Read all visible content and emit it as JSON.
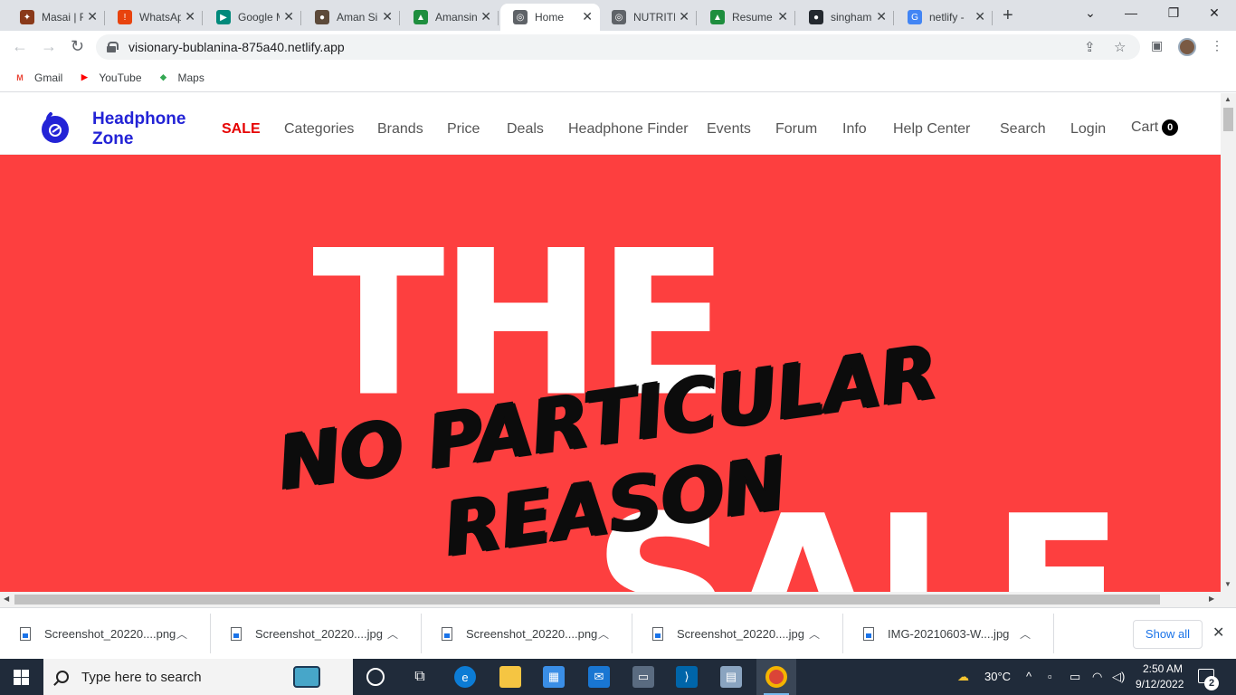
{
  "browser": {
    "tabs": [
      {
        "title": "Masai | F",
        "favicon": "masai-icon",
        "color": "#8a3a1a",
        "glyph": "✦"
      },
      {
        "title": "WhatsAp",
        "favicon": "whatsapp-alert-icon",
        "color": "#e8430e",
        "glyph": "!"
      },
      {
        "title": "Google M",
        "favicon": "google-meet-icon",
        "color": "#00897b",
        "glyph": "▶"
      },
      {
        "title": "Aman Si",
        "favicon": "profile-photo-icon",
        "color": "#5d4a3a",
        "glyph": "●"
      },
      {
        "title": "Amansin",
        "favicon": "google-drive-icon",
        "color": "#1e8e3e",
        "glyph": "▲"
      },
      {
        "title": "Home",
        "favicon": "globe-icon",
        "color": "#5f6368",
        "glyph": "◎",
        "active": true
      },
      {
        "title": "NUTRITI",
        "favicon": "globe-icon",
        "color": "#5f6368",
        "glyph": "◎"
      },
      {
        "title": "Resume",
        "favicon": "google-drive-icon",
        "color": "#1e8e3e",
        "glyph": "▲"
      },
      {
        "title": "singham",
        "favicon": "github-icon",
        "color": "#24292f",
        "glyph": "●"
      },
      {
        "title": "netlify -",
        "favicon": "google-icon",
        "color": "#4285f4",
        "glyph": "G"
      }
    ],
    "url": "visionary-bublanina-875a40.netlify.app",
    "bookmarks": [
      {
        "label": "Gmail",
        "icon": "gmail-icon",
        "glyph": "M",
        "color": "#ea4335"
      },
      {
        "label": "YouTube",
        "icon": "youtube-icon",
        "glyph": "▶",
        "color": "#ff0000"
      },
      {
        "label": "Maps",
        "icon": "google-maps-icon",
        "glyph": "◆",
        "color": "#34a853"
      }
    ]
  },
  "site": {
    "brand": "Headphone Zone",
    "brand_color": "#2323d6",
    "nav": [
      {
        "label": "SALE",
        "highlight": true
      },
      {
        "label": "Categories"
      },
      {
        "label": "Brands"
      },
      {
        "label": "Price"
      },
      {
        "label": "Deals"
      },
      {
        "label": "Headphone Finder"
      },
      {
        "label": "Events"
      },
      {
        "label": "Forum"
      },
      {
        "label": "Info"
      },
      {
        "label": "Help Center"
      },
      {
        "label": "Search"
      },
      {
        "label": "Login"
      }
    ],
    "cart_label": "Cart",
    "cart_count": "0",
    "hero": {
      "background": "#fd3f3f",
      "word_top": "THE",
      "word_bottom": "SALE",
      "tagline_line1": "NO PARTICULAR",
      "tagline_line2": "REASON"
    }
  },
  "downloads": [
    {
      "name": "Screenshot_20220....png"
    },
    {
      "name": "Screenshot_20220....jpg"
    },
    {
      "name": "Screenshot_20220....png"
    },
    {
      "name": "Screenshot_20220....jpg"
    },
    {
      "name": "IMG-20210603-W....jpg"
    }
  ],
  "downloads_show_all": "Show all",
  "taskbar": {
    "search_placeholder": "Type here to search",
    "weather": "30°C",
    "time": "2:50 AM",
    "date": "9/12/2022",
    "notifications": "2"
  }
}
